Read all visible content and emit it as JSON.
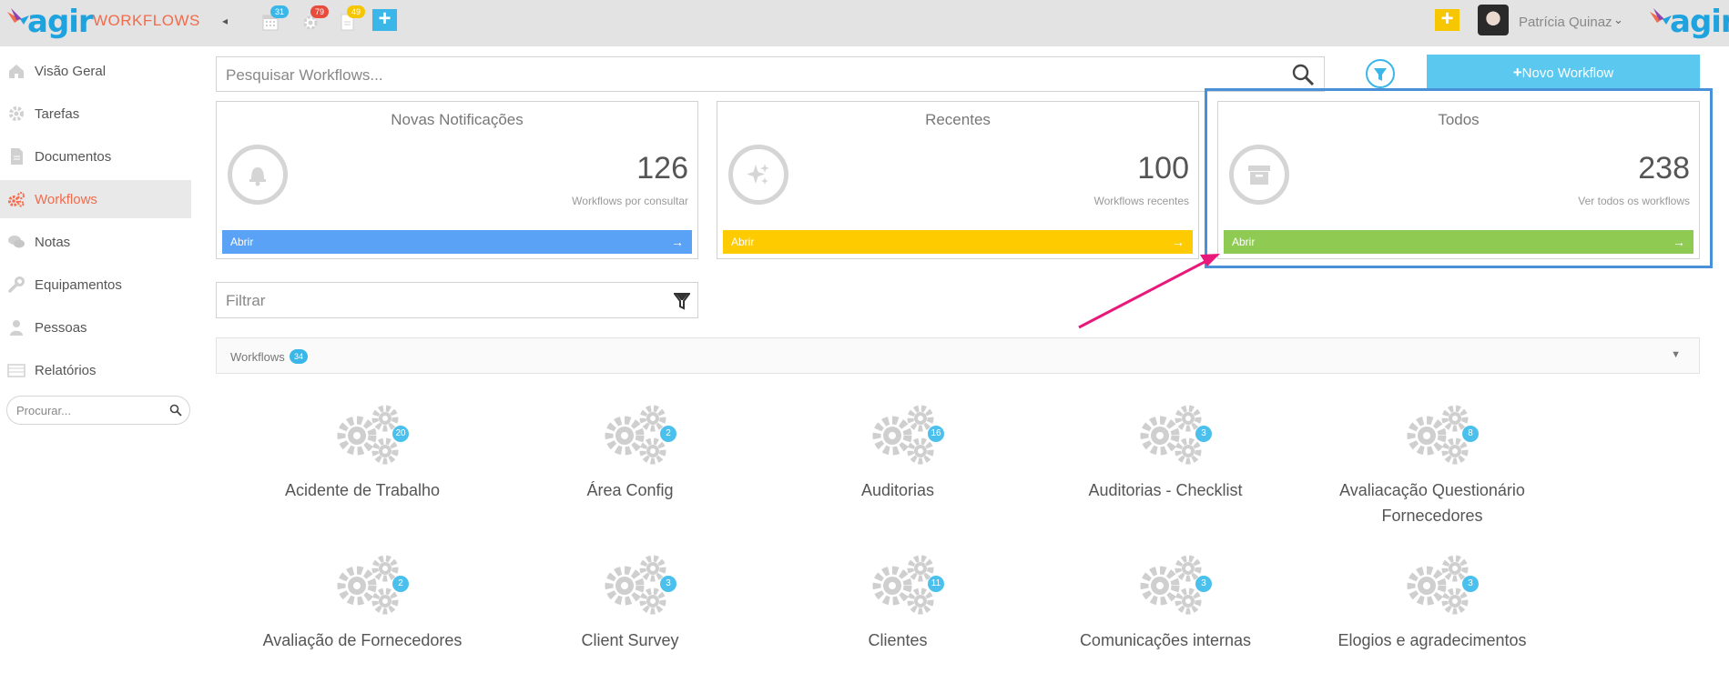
{
  "header": {
    "app_title": "WORKFLOWS",
    "logo_word": "agir",
    "badges": {
      "calendar": "31",
      "tasks": "79",
      "documents": "49"
    },
    "badge_colors": {
      "calendar": "#3ab7e8",
      "tasks": "#e84c3d",
      "documents": "#f6c600"
    },
    "user_name": "Patrícia Quinaz",
    "caret": "⌄",
    "collapse": "◂"
  },
  "sidebar": {
    "items": [
      {
        "label": "Visão Geral",
        "icon": "home-icon"
      },
      {
        "label": "Tarefas",
        "icon": "gear-icon"
      },
      {
        "label": "Documentos",
        "icon": "document-icon"
      },
      {
        "label": "Workflows",
        "icon": "workflows-icon",
        "active": true
      },
      {
        "label": "Notas",
        "icon": "chat-icon"
      },
      {
        "label": "Equipamentos",
        "icon": "wrench-icon"
      },
      {
        "label": "Pessoas",
        "icon": "person-icon"
      },
      {
        "label": "Relatórios",
        "icon": "report-icon"
      }
    ],
    "search_placeholder": "Procurar..."
  },
  "main": {
    "search_placeholder": "Pesquisar Workflows...",
    "new_button": "Novo Workflow",
    "cards": [
      {
        "title": "Novas Notificações",
        "count": "126",
        "subtitle": "Workflows por consultar",
        "button": "Abrir",
        "color": "#5aa2f5"
      },
      {
        "title": "Recentes",
        "count": "100",
        "subtitle": "Workflows recentes",
        "button": "Abrir",
        "color": "#fecb00"
      },
      {
        "title": "Todos",
        "count": "238",
        "subtitle": "Ver todos os workflows",
        "button": "Abrir",
        "color": "#8fcb53"
      }
    ],
    "filter_placeholder": "Filtrar",
    "workflows_label": "Workflows",
    "workflows_count": "34",
    "workflows": [
      {
        "name": "Acidente de Trabalho",
        "count": "20"
      },
      {
        "name": "Área Config",
        "count": "2"
      },
      {
        "name": "Auditorias",
        "count": "16"
      },
      {
        "name": "Auditorias - Checklist",
        "count": "3"
      },
      {
        "name": "Avaliacação Questionário Fornecedores",
        "count": "8"
      },
      {
        "name": "Avaliação de Fornecedores",
        "count": "2"
      },
      {
        "name": "Client Survey",
        "count": "3"
      },
      {
        "name": "Clientes",
        "count": "11"
      },
      {
        "name": "Comunicações internas",
        "count": "3"
      },
      {
        "name": "Elogios e agradecimentos",
        "count": "3"
      }
    ]
  },
  "colors": {
    "accent": "#f26b4c",
    "primary": "#3ab7e8",
    "annotation_box": "#4a90d9",
    "annotation_arrow": "#e8197a"
  }
}
